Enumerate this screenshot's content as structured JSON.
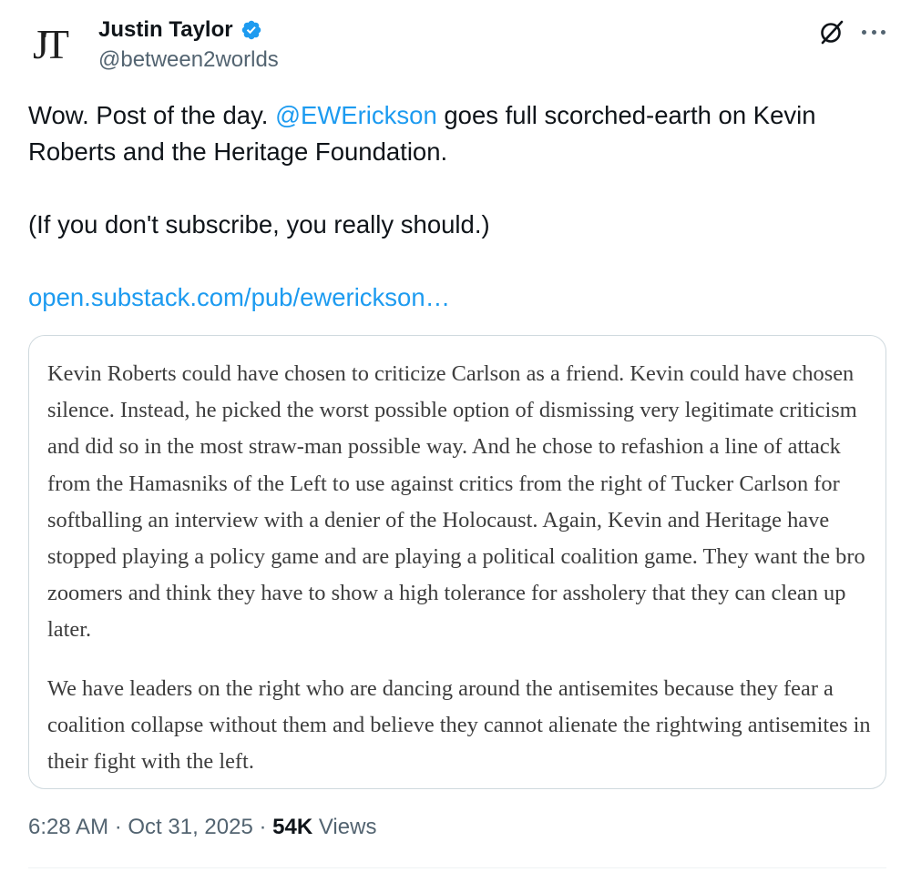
{
  "author": {
    "avatar_text": "JT",
    "display_name": "Justin Taylor",
    "handle": "@between2worlds"
  },
  "tweet": {
    "intro": "Wow. Post of the day. ",
    "mention": "@EWErickson",
    "rest_line": " goes full scorched-earth on Kevin Roberts and the Heritage Foundation.",
    "note": "(If you don't subscribe, you really should.)",
    "link": "open.substack.com/pub/ewerickson…"
  },
  "quote": {
    "paragraph_1": "Kevin Roberts could have chosen to criticize Carlson as a friend. Kevin could have chosen silence. Instead, he picked the worst possible option of dismissing very legitimate criticism and did so in the most straw-man possible way. And he chose to refashion a line of attack from the Hamasniks of the Left to use against critics from the right of Tucker Carlson for softballing an interview with a denier of the Holocaust. Again, Kevin and Heritage have stopped playing a policy game and are playing a political coalition game. They want the bro zoomers and think they have to show a high tolerance for assholery that they can clean up later.",
    "paragraph_2": "We have leaders on the right who are dancing around the antisemites because they fear a coalition collapse without them and believe they cannot alienate the rightwing antisemites in their fight with the left."
  },
  "meta": {
    "time": "6:28 AM",
    "separator": " · ",
    "date": "Oct 31, 2025",
    "views_count": "54K",
    "views_label": " Views"
  },
  "icons": {
    "verified": "verified-badge-icon",
    "grok": "grok-icon",
    "more": "more-options-icon"
  },
  "colors": {
    "accent": "#1d9bf0",
    "secondary_text": "#536471",
    "border": "#cfd9de"
  }
}
